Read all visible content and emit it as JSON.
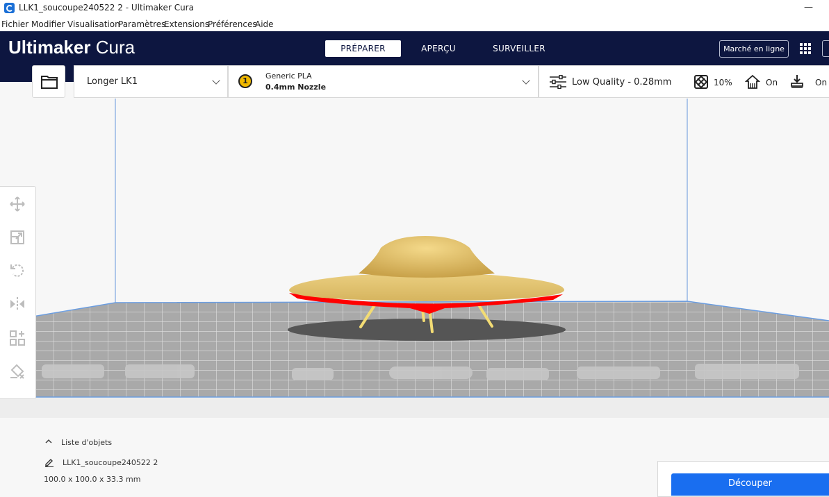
{
  "window": {
    "title": "LLK1_soucoupe240522 2 - Ultimaker Cura",
    "minimize_glyph": "—"
  },
  "menu": [
    "Fichier",
    "Modifier",
    "Visualisation",
    "Paramètres",
    "Extensions",
    "Préférences",
    "Aide"
  ],
  "header": {
    "logo_bold": "Ultimaker",
    "logo_light": "Cura",
    "stages": [
      "PRÉPARER",
      "APERÇU",
      "SURVEILLER"
    ],
    "marketplace": "Marché en ligne"
  },
  "toolbar": {
    "printer": "Longer LK1",
    "extruder_number": "1",
    "material": "Generic PLA",
    "nozzle": "0.4mm Nozzle",
    "quality": "Low Quality - 0.28mm",
    "infill": "10%",
    "support": "On",
    "adhesion": "On"
  },
  "object_list": {
    "header": "Liste d'objets",
    "object_name": "LLK1_soucoupe240522 2",
    "dimensions": "100.0 x 100.0 x 33.3 mm"
  },
  "slice_button": "Découper",
  "colors": {
    "header_bg": "#0d1640",
    "slice_blue": "#196ef0",
    "model_yellow": "#e8c46a",
    "support_red": "#ff0000",
    "extruder_badge": "#f0b800"
  },
  "icons": {
    "toolbar": [
      "folder-icon",
      "chevron-down-icon",
      "sliders-icon",
      "infill-icon",
      "support-icon",
      "adhesion-icon"
    ],
    "left_tools": [
      "move-icon",
      "scale-icon",
      "rotate-icon",
      "mirror-icon",
      "per-model-settings-icon",
      "support-blocker-icon"
    ]
  }
}
